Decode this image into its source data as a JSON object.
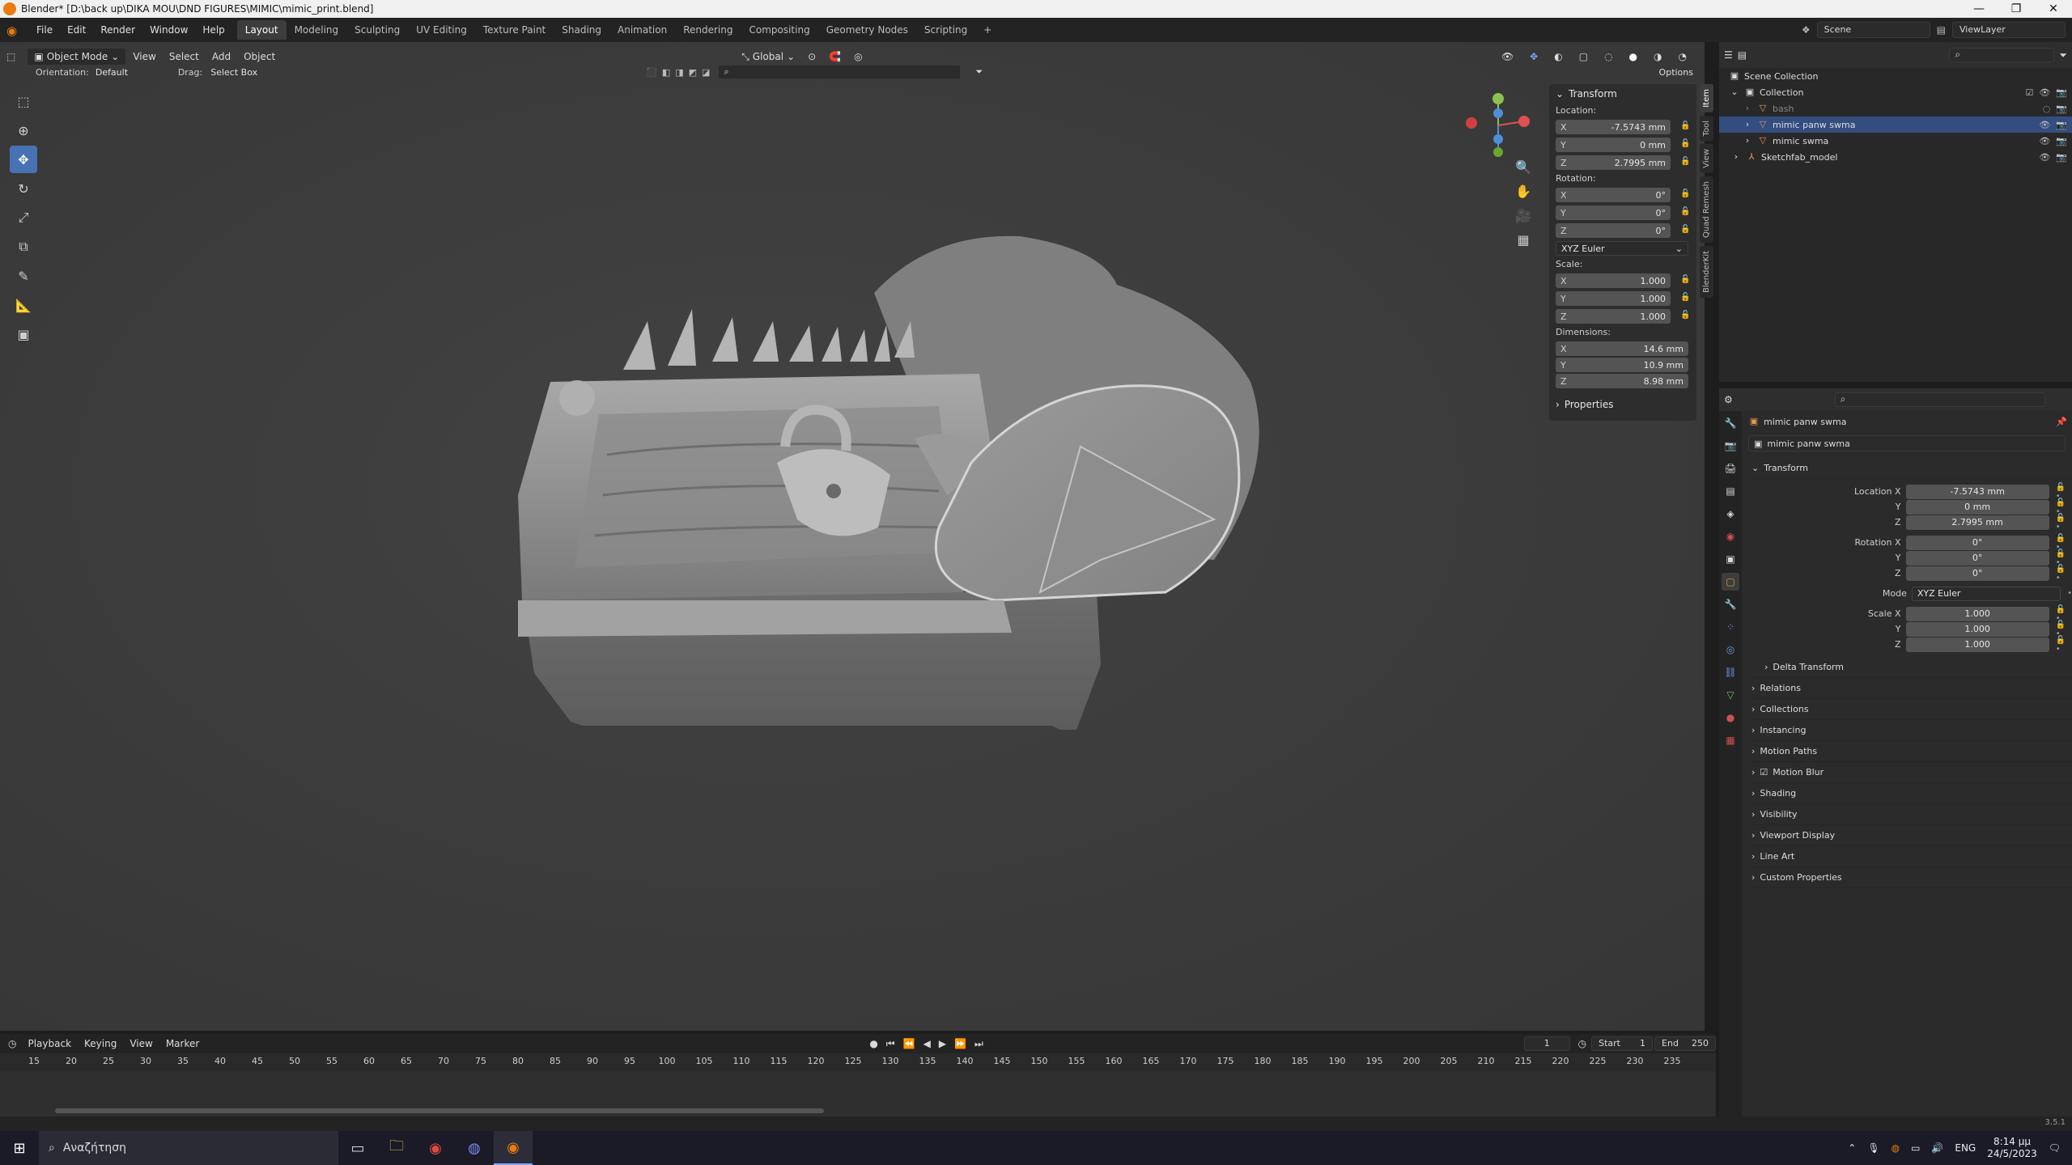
{
  "window": {
    "title": "Blender* [D:\\back up\\DIKA MOU\\DND FIGURES\\MIMIC\\mimic_print.blend]",
    "min": "—",
    "max": "❐",
    "close": "✕"
  },
  "menu": [
    "File",
    "Edit",
    "Render",
    "Window",
    "Help"
  ],
  "workspaces": [
    "Layout",
    "Modeling",
    "Sculpting",
    "UV Editing",
    "Texture Paint",
    "Shading",
    "Animation",
    "Rendering",
    "Compositing",
    "Geometry Nodes",
    "Scripting"
  ],
  "workspace_add": "+",
  "scene": "Scene",
  "view_layer": "ViewLayer",
  "viewport": {
    "mode": "Object Mode",
    "menus": [
      "View",
      "Select",
      "Add",
      "Object"
    ],
    "orientation_label": "Orientation:",
    "orientation_value": "Default",
    "drag_label": "Drag:",
    "drag_value": "Select Box",
    "transform_orientation": "Global",
    "options": "Options"
  },
  "npanel": {
    "header": "Transform",
    "location_label": "Location:",
    "location": {
      "x": "-7.5743 mm",
      "y": "0 mm",
      "z": "2.7995 mm"
    },
    "rotation_label": "Rotation:",
    "rotation": {
      "x": "0°",
      "y": "0°",
      "z": "0°"
    },
    "rotation_mode": "XYZ Euler",
    "scale_label": "Scale:",
    "scale": {
      "x": "1.000",
      "y": "1.000",
      "z": "1.000"
    },
    "dimensions_label": "Dimensions:",
    "dimensions": {
      "x": "14.6 mm",
      "y": "10.9 mm",
      "z": "8.98 mm"
    },
    "properties": "Properties",
    "axis": {
      "x": "X",
      "y": "Y",
      "z": "Z"
    }
  },
  "side_tabs": [
    "Item",
    "Tool",
    "View",
    "Quad Remesh",
    "BlenderKit"
  ],
  "outliner": {
    "root": "Scene Collection",
    "items": [
      {
        "name": "Collection"
      },
      {
        "name": "bash"
      },
      {
        "name": "mimic panw swma"
      },
      {
        "name": "mimic swma"
      },
      {
        "name": "Sketchfab_model"
      }
    ]
  },
  "properties": {
    "object_name": "mimic panw swma",
    "data_name": "mimic panw swma",
    "transform": "Transform",
    "location_x_label": "Location X",
    "rotation_x_label": "Rotation X",
    "scale_x_label": "Scale X",
    "y_label": "Y",
    "z_label": "Z",
    "mode_label": "Mode",
    "location": {
      "x": "-7.5743 mm",
      "y": "0 mm",
      "z": "2.7995 mm"
    },
    "rotation": {
      "x": "0°",
      "y": "0°",
      "z": "0°"
    },
    "mode": "XYZ Euler",
    "scale": {
      "x": "1.000",
      "y": "1.000",
      "z": "1.000"
    },
    "delta_transform": "Delta Transform",
    "sections": [
      "Relations",
      "Collections",
      "Instancing",
      "Motion Paths",
      "Motion Blur",
      "Shading",
      "Visibility",
      "Viewport Display",
      "Line Art",
      "Custom Properties"
    ]
  },
  "timeline": {
    "menus": [
      "Playback",
      "Keying",
      "View",
      "Marker"
    ],
    "current_frame": "1",
    "start_label": "Start",
    "start": "1",
    "end_label": "End",
    "end": "250",
    "ticks": [
      "15",
      "20",
      "25",
      "30",
      "35",
      "40",
      "45",
      "50",
      "55",
      "60",
      "65",
      "70",
      "75",
      "80",
      "85",
      "90",
      "95",
      "100",
      "105",
      "110",
      "115",
      "120",
      "125",
      "130",
      "135",
      "140",
      "145",
      "150",
      "155",
      "160",
      "165",
      "170",
      "175",
      "180",
      "185",
      "190",
      "195",
      "200",
      "205",
      "210",
      "215",
      "220",
      "225",
      "230",
      "235"
    ]
  },
  "version": "3.5.1",
  "taskbar": {
    "search_placeholder": "Αναζήτηση",
    "lang": "ENG",
    "time": "8:14 μμ",
    "date": "24/5/2023"
  },
  "colors": {
    "accent": "#4772b3",
    "blender_orange": "#e87d0d",
    "selection": "#334d80"
  }
}
